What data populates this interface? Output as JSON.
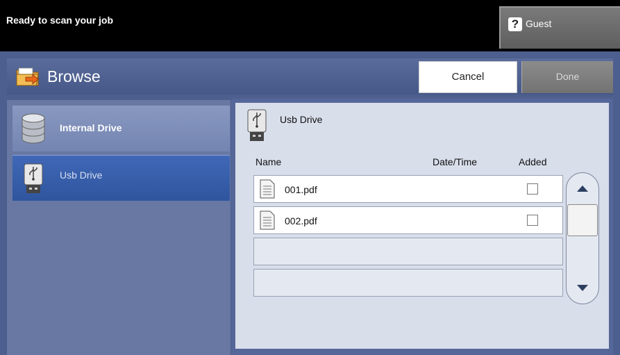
{
  "status": {
    "text": "Ready to scan your job"
  },
  "user": {
    "label": "Guest",
    "icon": "help-key-icon"
  },
  "header": {
    "title": "Browse",
    "icon": "folder-browse-icon",
    "cancel_label": "Cancel",
    "done_label": "Done"
  },
  "drives": [
    {
      "label": "Internal Drive",
      "icon": "database-icon",
      "selected": false
    },
    {
      "label": "Usb Drive",
      "icon": "usb-drive-icon",
      "selected": true
    }
  ],
  "content": {
    "location_label": "Usb Drive",
    "columns": {
      "name": "Name",
      "datetime": "Date/Time",
      "added": "Added"
    },
    "files": [
      {
        "name": "001.pdf",
        "date": "",
        "added": false
      },
      {
        "name": "002.pdf",
        "date": "",
        "added": false
      }
    ]
  },
  "colors": {
    "frame": "#4d5f8e",
    "selected_item": "#3a62b0",
    "panel": "#d8deea"
  }
}
